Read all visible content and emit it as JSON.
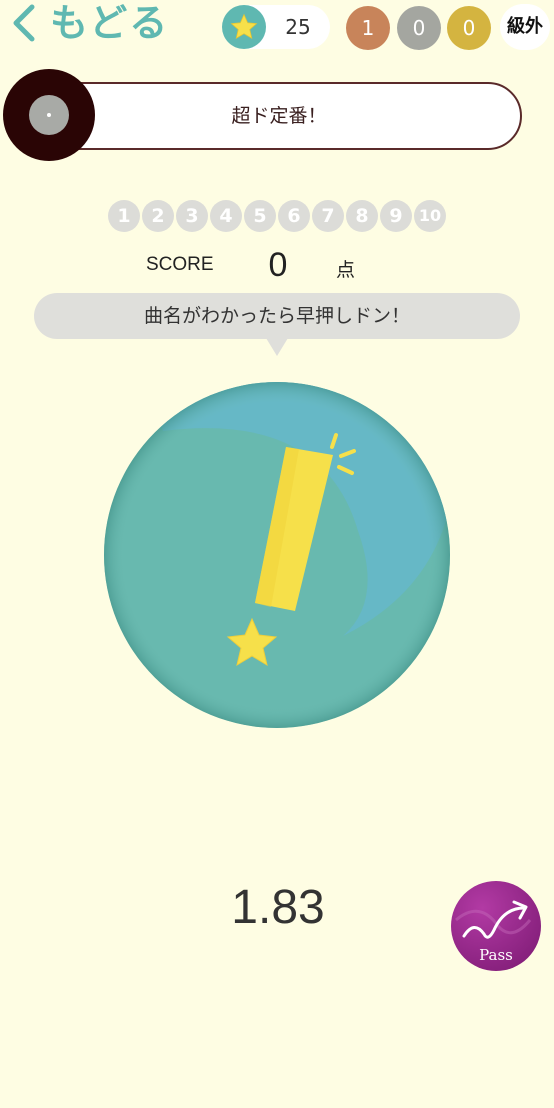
{
  "header": {
    "back_label": "もどる",
    "star_count": "25",
    "medals": {
      "bronze": "1",
      "silver": "0",
      "gold": "0"
    },
    "grade": "級外"
  },
  "genre": {
    "title": "超ド定番！"
  },
  "questions": [
    "1",
    "2",
    "3",
    "4",
    "5",
    "6",
    "7",
    "8",
    "9",
    "10"
  ],
  "score": {
    "label": "SCORE",
    "value": "0",
    "unit": "点"
  },
  "prompt": {
    "text": "曲名がわかったら早押しドン！"
  },
  "timer": {
    "value": "1.83"
  },
  "pass_button": {
    "label": "Pass"
  },
  "colors": {
    "background": "#fefde3",
    "accent_teal": "#5fb8b1",
    "buzzer_teal": "#6bbab0",
    "exclamation_yellow": "#f6e04a",
    "pass_purple": "#9a2a8e",
    "bronze": "#c8845a",
    "silver": "#a4a6a0",
    "gold": "#d4b440"
  }
}
